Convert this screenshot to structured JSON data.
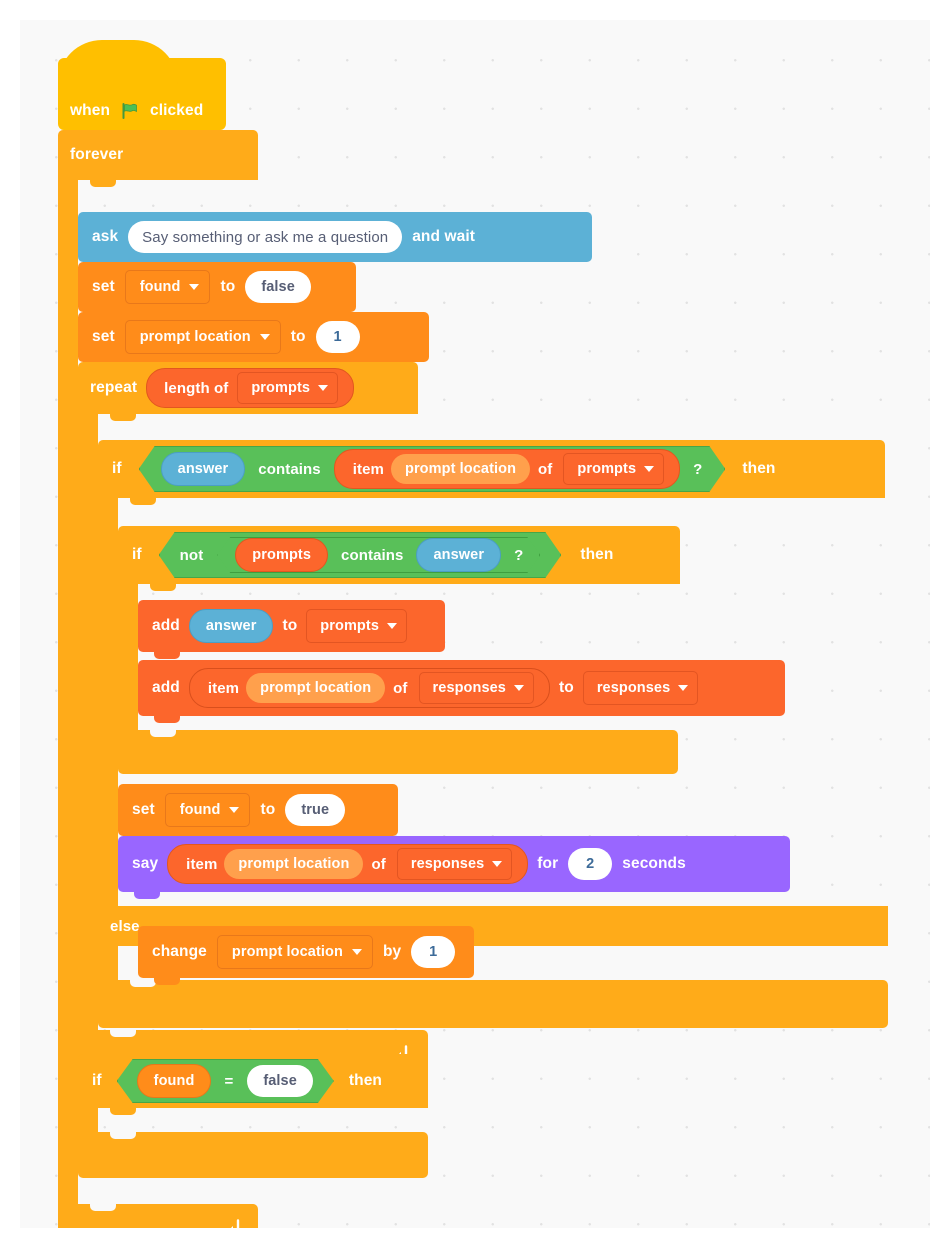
{
  "app": {
    "name": "Scratch Block Editor",
    "canvas_background": "#f9f9f9"
  },
  "colors": {
    "events": "#ffbf00",
    "control": "#ffab19",
    "sensing": "#5cb1d6",
    "variables": "#ff8c1a",
    "lists": "#fc662c",
    "looks": "#9966ff",
    "operators": "#59c059",
    "input_white": "#ffffff",
    "text_dark": "#575e75"
  },
  "script": {
    "hat": {
      "when_label": "when",
      "flag_icon": "green-flag-icon",
      "clicked_label": "clicked"
    },
    "forever": {
      "label": "forever"
    },
    "ask": {
      "ask_label": "ask",
      "question_value": "Say something or ask me a question",
      "and_wait_label": "and wait"
    },
    "set_found_false": {
      "set_label": "set",
      "variable": "found",
      "to_label": "to",
      "value": "false"
    },
    "set_prompt_location_1": {
      "set_label": "set",
      "variable": "prompt location",
      "to_label": "to",
      "value": "1"
    },
    "repeat": {
      "repeat_label": "repeat",
      "length_of_label": "length of",
      "list": "prompts"
    },
    "if_outer": {
      "if_label": "if",
      "then_label": "then",
      "else_label": "else",
      "condition": {
        "left": "answer",
        "operator": "contains",
        "item_label": "item",
        "index": "prompt location",
        "of_label": "of",
        "list": "prompts",
        "question_mark": "?"
      }
    },
    "if_inner": {
      "if_label": "if",
      "then_label": "then",
      "condition": {
        "not_label": "not",
        "list": "prompts",
        "operator": "contains",
        "right": "answer",
        "question_mark": "?"
      }
    },
    "add_answer_to_prompts": {
      "add_label": "add",
      "value": "answer",
      "to_label": "to",
      "list": "prompts"
    },
    "add_item_to_responses": {
      "add_label": "add",
      "item_label": "item",
      "index": "prompt location",
      "of_label": "of",
      "source_list": "responses",
      "to_label": "to",
      "target_list": "responses"
    },
    "set_found_true": {
      "set_label": "set",
      "variable": "found",
      "to_label": "to",
      "value": "true"
    },
    "say": {
      "say_label": "say",
      "item_label": "item",
      "index": "prompt location",
      "of_label": "of",
      "list": "responses",
      "for_label": "for",
      "seconds_value": "2",
      "seconds_label": "seconds"
    },
    "change_prompt_location": {
      "change_label": "change",
      "variable": "prompt location",
      "by_label": "by",
      "value": "1"
    },
    "if_found_false": {
      "if_label": "if",
      "variable": "found",
      "operator": "=",
      "value": "false",
      "then_label": "then"
    },
    "loop_arrow_icon": "loop-arrow-icon"
  }
}
